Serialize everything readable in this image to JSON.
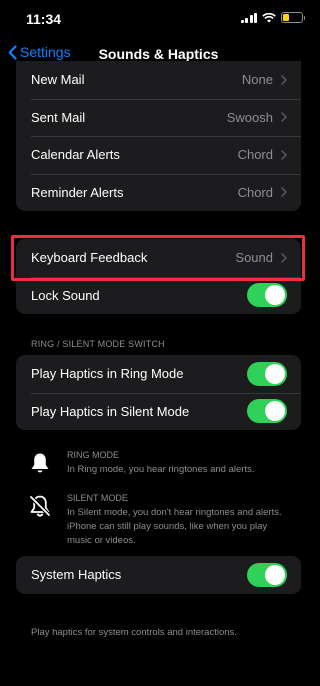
{
  "status": {
    "time": "11:34",
    "battery_level": 0.35,
    "accent_battery": "#ffd60a"
  },
  "nav": {
    "back_label": "Settings",
    "title": "Sounds & Haptics"
  },
  "alerts": [
    {
      "label": "New Mail",
      "value": "None"
    },
    {
      "label": "Sent Mail",
      "value": "Swoosh"
    },
    {
      "label": "Calendar Alerts",
      "value": "Chord"
    },
    {
      "label": "Reminder Alerts",
      "value": "Chord"
    }
  ],
  "keyboard": {
    "feedback_label": "Keyboard Feedback",
    "feedback_value": "Sound",
    "lock_label": "Lock Sound",
    "lock_on": true
  },
  "ring_section": {
    "header": "RING / SILENT MODE SWITCH",
    "ring_haptics_label": "Play Haptics in Ring Mode",
    "ring_haptics_on": true,
    "silent_haptics_label": "Play Haptics in Silent Mode",
    "silent_haptics_on": true
  },
  "ring_mode": {
    "icon": "bell-icon",
    "title": "RING MODE",
    "body": "In Ring mode, you hear ringtones and alerts."
  },
  "silent_mode": {
    "icon": "bell-slash-icon",
    "title": "SILENT MODE",
    "body": "In Silent mode, you don't hear ringtones and alerts. iPhone can still play sounds, like when you play music or videos."
  },
  "system": {
    "label": "System Haptics",
    "on": true,
    "footer": "Play haptics for system controls and interactions."
  },
  "colors": {
    "accent": "#0a84ff",
    "toggle_on": "#30d158",
    "highlight": "#e8303f"
  }
}
